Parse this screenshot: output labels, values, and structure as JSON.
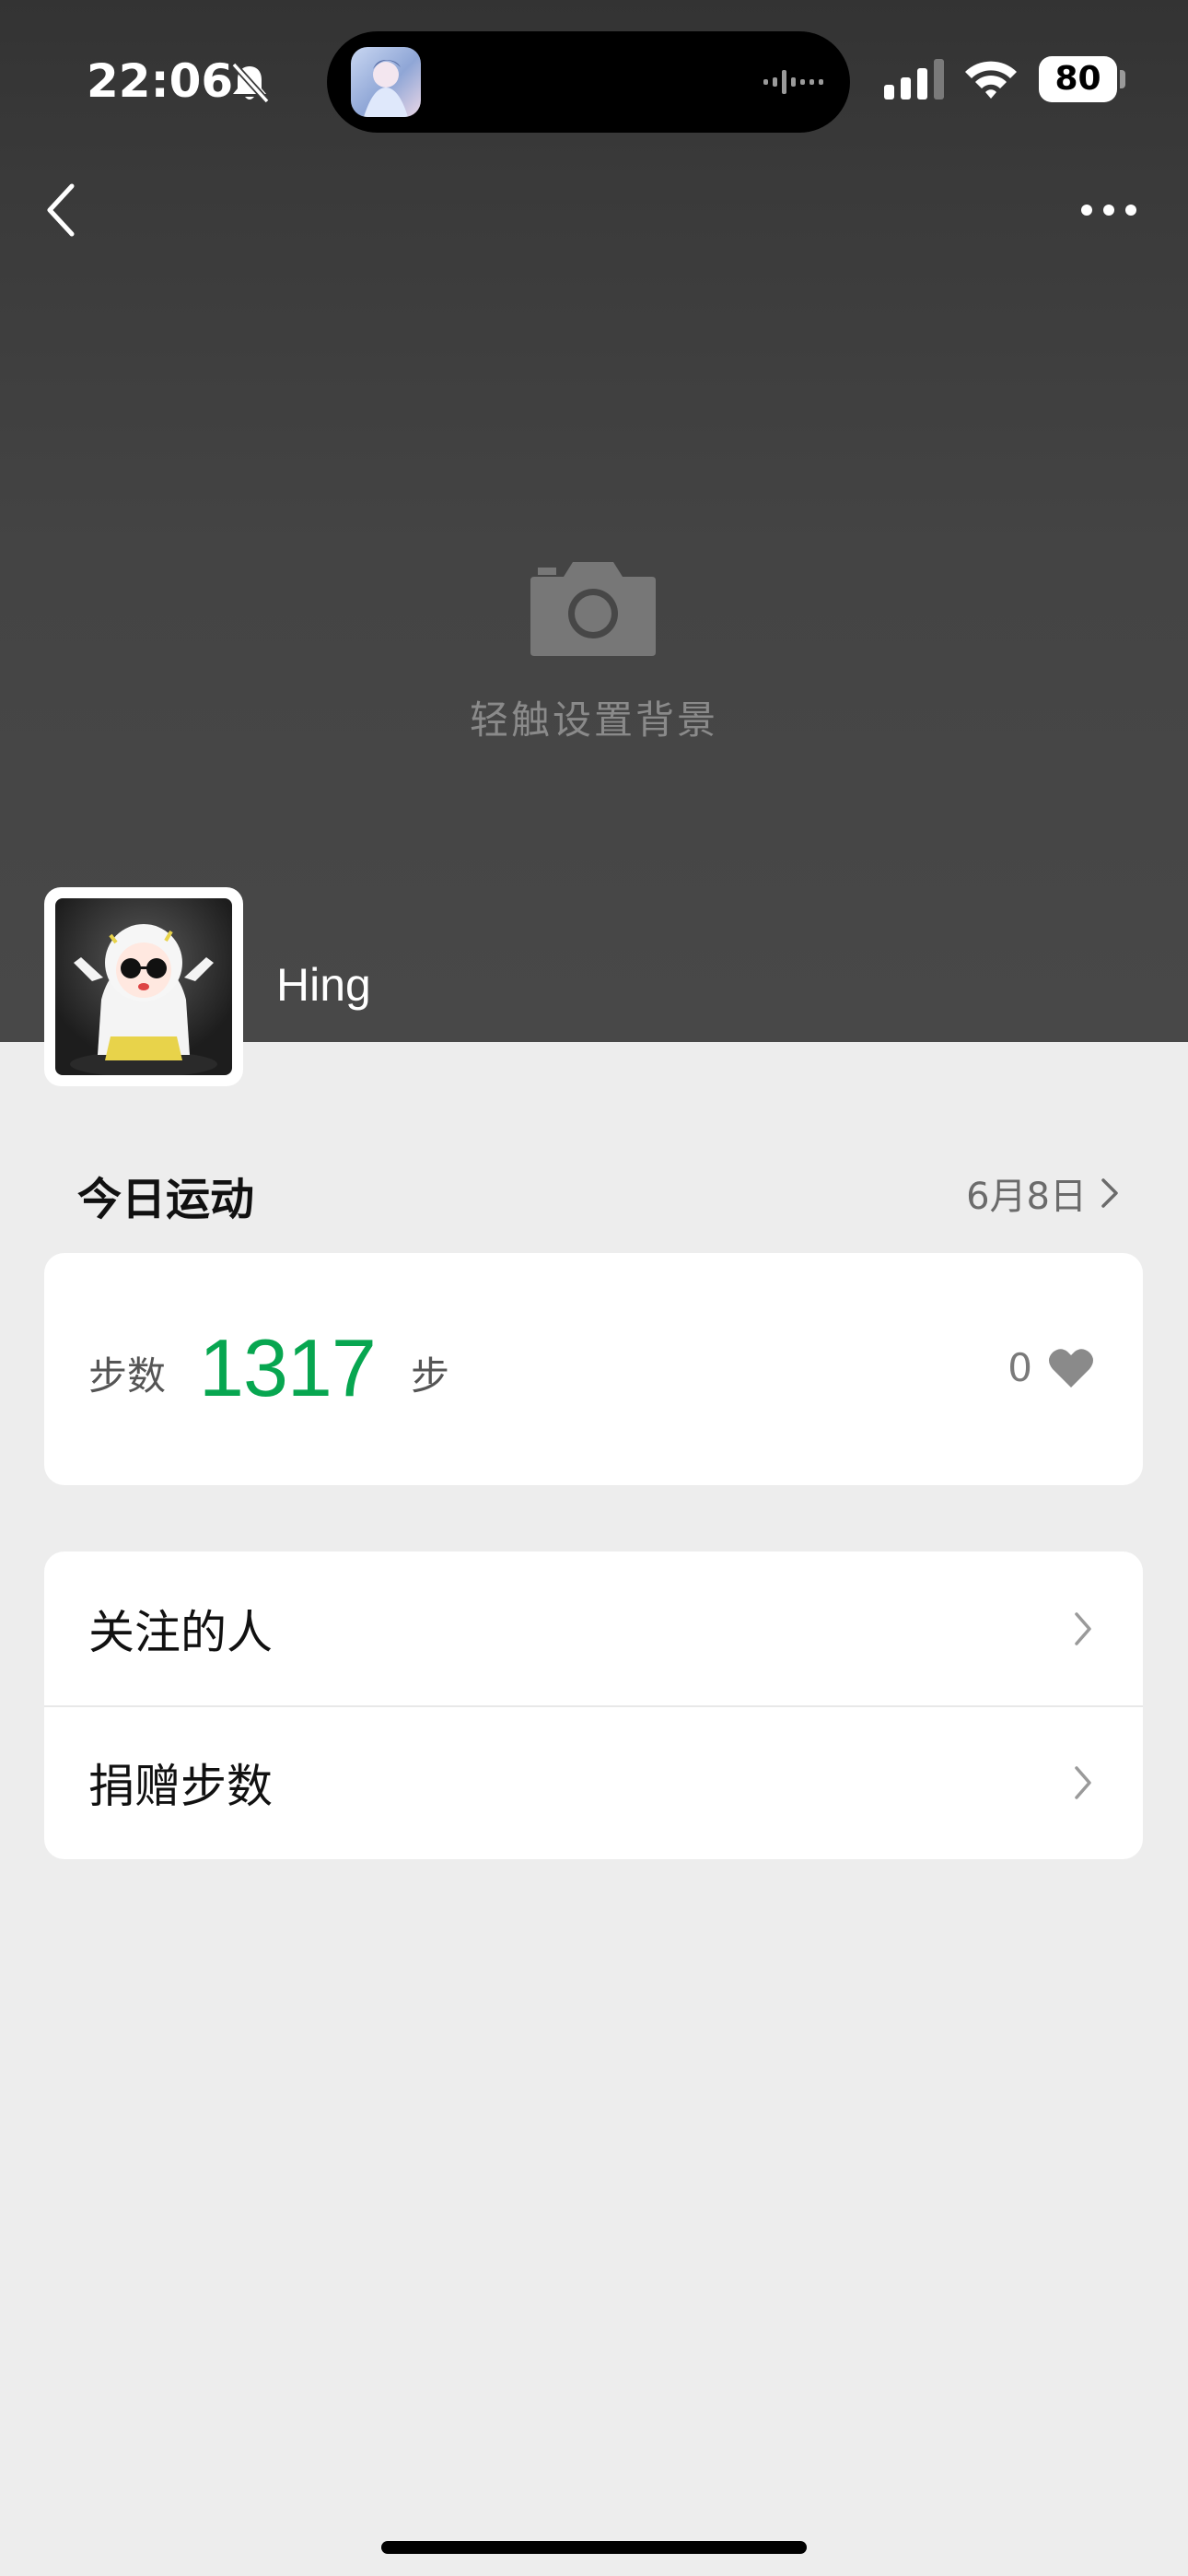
{
  "status_bar": {
    "time": "22:06",
    "battery": "80",
    "icons": [
      "bell-slash-icon",
      "signal-icon",
      "wifi-icon",
      "battery-icon"
    ]
  },
  "nav": {
    "back_icon": "chevron-left-icon",
    "more_icon": "more-dots-icon"
  },
  "cover": {
    "icon": "camera-icon",
    "hint": "轻触设置背景"
  },
  "profile": {
    "name": "Hing"
  },
  "today": {
    "title": "今日运动",
    "date": "6月8日",
    "steps_label": "步数",
    "steps_value": "1317",
    "steps_unit": "步",
    "likes": "0"
  },
  "menu": {
    "items": [
      {
        "label": "关注的人"
      },
      {
        "label": "捐赠步数"
      }
    ]
  },
  "colors": {
    "accent_green": "#07a650",
    "page_bg": "#ededed",
    "header_bg": "#404040"
  }
}
